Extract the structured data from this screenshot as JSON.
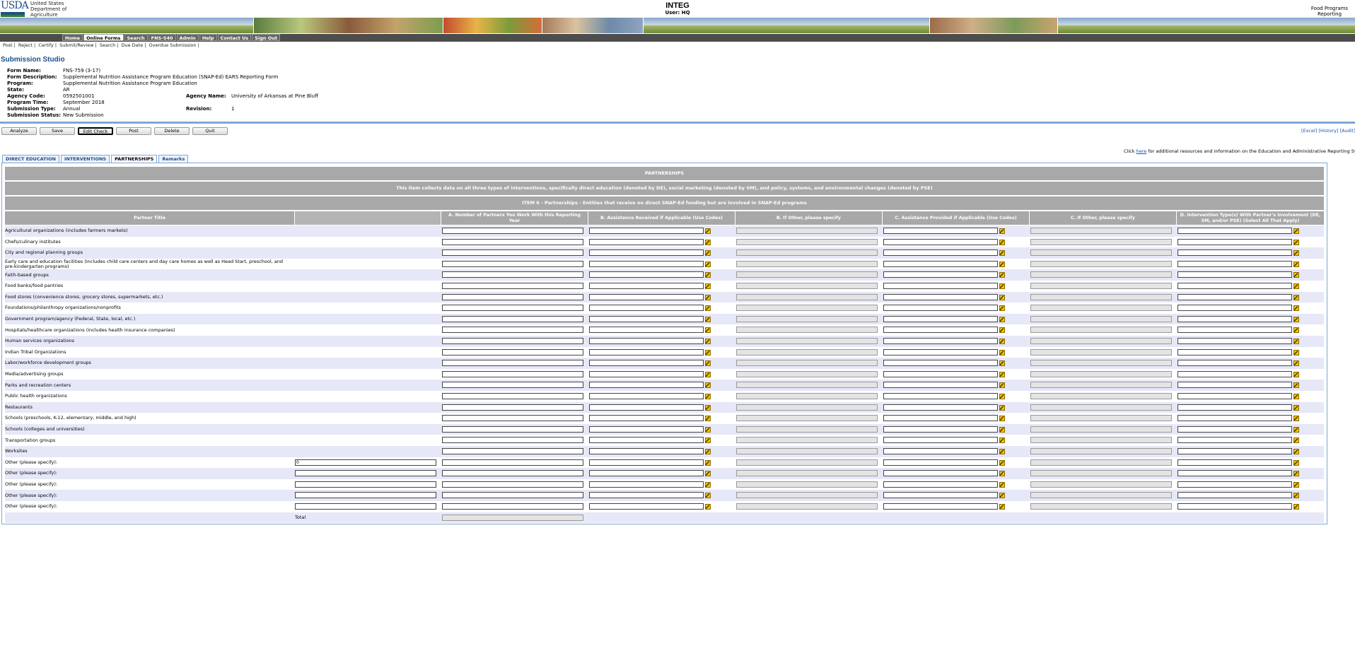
{
  "header": {
    "org_logo_text": "USDA",
    "department": "United States Department of Agriculture",
    "app_title": "INTEG",
    "user_line": "User: HQ",
    "system_name": "Food Programs Reporting System"
  },
  "nav": {
    "tabs": [
      "Home",
      "Online Forms",
      "Search",
      "FNS-540",
      "Admin",
      "Help",
      "Contact Us",
      "Sign Out"
    ],
    "active_tab": "Online Forms",
    "sub_links": [
      "Post",
      "Reject",
      "Certify",
      "Submit/Review",
      "Search",
      "Due Date",
      "Overdue Submission"
    ]
  },
  "studio": {
    "title": "Submission Studio",
    "fields": {
      "form_name": {
        "label": "Form Name:",
        "value": "FNS-759 (3-17)"
      },
      "form_description": {
        "label": "Form Description:",
        "value": "Supplemental Nutrition Assistance Program Education (SNAP-Ed) EARS Reporting Form"
      },
      "program": {
        "label": "Program:",
        "value": "Supplemental Nutrition Assistance Program Education"
      },
      "state": {
        "label": "State:",
        "value": "AR"
      },
      "agency_code": {
        "label": "Agency Code:",
        "value": "0592501001"
      },
      "agency_name": {
        "label": "Agency Name:",
        "value": "University of Arkansas at Pine Bluff"
      },
      "program_time": {
        "label": "Program Time:",
        "value": "September 2018"
      },
      "submission_type": {
        "label": "Submission Type:",
        "value": "Annual"
      },
      "revision": {
        "label": "Revision:",
        "value": "1"
      },
      "submission_status": {
        "label": "Submission Status:",
        "value": "New Submission"
      }
    }
  },
  "buttons": {
    "analyze": "Analyze",
    "save": "Save",
    "edit_check": "Edit Check",
    "post": "Post",
    "delete": "Delete",
    "quit": "Quit"
  },
  "top_links": "[Excel] [History] [Audit]",
  "resources_note": {
    "prefix": "Click",
    "link": "here",
    "suffix": "for additional resources and information on the Education and Administrative Reporting System"
  },
  "tabs": [
    "DIRECT EDUCATION",
    "INTERVENTIONS",
    "PARTNERSHIPS",
    "Remarks"
  ],
  "active_tab": "PARTNERSHIPS",
  "section": {
    "title": "PARTNERSHIPS",
    "description": "This item collects data on all three types of interventions, specifically direct education (denoted by DE), social marketing (denoted by SM), and policy, systems, and environmental changes (denoted by PSE)",
    "item_title": "ITEM 6 - Partnerships - Entities that receive no direct SNAP-Ed funding but are involved in SNAP-Ed programs"
  },
  "columns": {
    "partner_title": "Partner Title",
    "a": "A. Number of Partners You Work With this Reporting Year",
    "b": "B. Assistance Received if Applicable (Use Codes)",
    "b_other": "B. If Other, please specify",
    "c": "C. Assistance Provided if Applicable (Use Codes)",
    "c_other": "C. If Other, please specify",
    "d": "D. Intervention Type(s) With Partner's Involvement (DE, SM, and/or PSE) (Select All That Apply)"
  },
  "rows": [
    {
      "title": "Agricultural organizations (includes farmers markets)"
    },
    {
      "title": "Chefs/culinary institutes"
    },
    {
      "title": "City and regional planning groups"
    },
    {
      "title": "Early care and education facilities (includes child care centers and day care homes as well as Head Start, preschool, and pre-kindergarten programs)"
    },
    {
      "title": "Faith-based groups"
    },
    {
      "title": "Food banks/food pantries"
    },
    {
      "title": "Food stores (convenience stores, grocery stores, supermarkets, etc.)"
    },
    {
      "title": "Foundations/philanthropy organizations/nonprofits"
    },
    {
      "title": "Government program/agency (Federal, State, local, etc.)"
    },
    {
      "title": "Hospitals/healthcare organizations (includes health insurance companies)"
    },
    {
      "title": "Human services organizations"
    },
    {
      "title": "Indian Tribal Organizations"
    },
    {
      "title": "Labor/workforce development groups"
    },
    {
      "title": "Media/advertising groups"
    },
    {
      "title": "Parks and recreation centers"
    },
    {
      "title": "Public health organizations"
    },
    {
      "title": "Restaurants"
    },
    {
      "title": "Schools (preschools, K-12, elementary, middle, and high)"
    },
    {
      "title": "Schools (colleges and universities)"
    },
    {
      "title": "Transportation groups"
    },
    {
      "title": "Worksites"
    },
    {
      "title": "Other (please specify):",
      "other": true,
      "specify_value": "0"
    },
    {
      "title": "Other (please specify):",
      "other": true,
      "specify_value": ""
    },
    {
      "title": "Other (please specify):",
      "other": true,
      "specify_value": ""
    },
    {
      "title": "Other (please specify):",
      "other": true,
      "specify_value": ""
    },
    {
      "title": "Other (please specify):",
      "other": true,
      "specify_value": ""
    }
  ],
  "total_label": "Total"
}
